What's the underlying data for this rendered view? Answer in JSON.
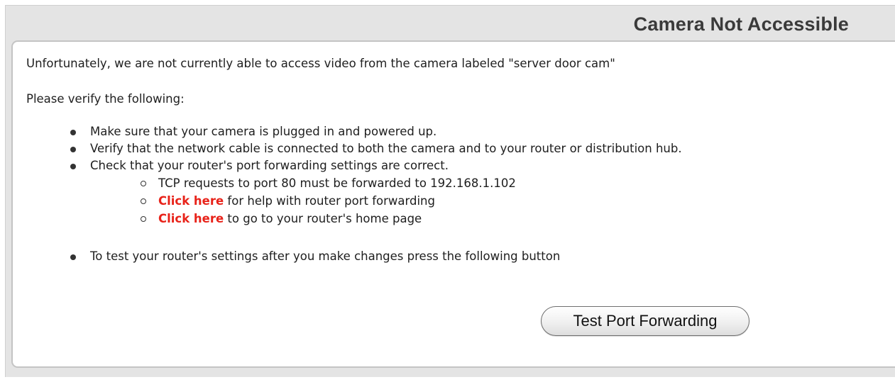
{
  "dialog": {
    "title": "Camera Not Accessible",
    "intro": "Unfortunately, we are not currently able to access video from the camera labeled \"server door cam\"",
    "verify_heading": "Please verify the following:",
    "checklist": [
      "Make sure that your camera is plugged in and powered up.",
      "Verify that the network cable is connected to both the camera and to your router or distribution hub.",
      "Check that your router's port forwarding settings are correct."
    ],
    "sub_items": {
      "tcp_note": "TCP requests to port 80 must be forwarded to 192.168.1.102",
      "help_link_label": "Click here",
      "help_link_suffix": " for help with router port forwarding",
      "home_link_label": "Click here",
      "home_link_suffix": " to go to your router's home page"
    },
    "test_instruction": "To test your router's settings after you make changes press the following button",
    "test_button_label": "Test Port Forwarding"
  },
  "colors": {
    "link": "#e8231a",
    "panel_background": "#e4e4e4",
    "title_text": "#3a3a3a"
  }
}
